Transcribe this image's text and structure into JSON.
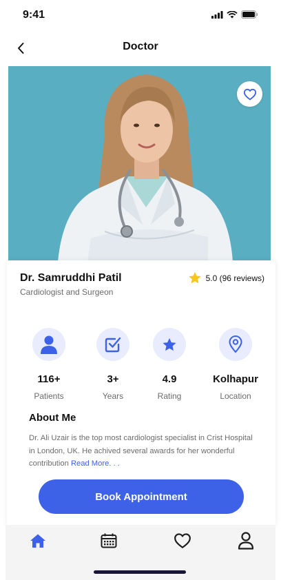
{
  "status_bar": {
    "time": "9:41"
  },
  "header": {
    "title": "Doctor"
  },
  "doctor": {
    "name": "Dr. Samruddhi Patil",
    "specialty": "Cardiologist and Surgeon",
    "rating_text": "5.0 (96 reviews)"
  },
  "stats": [
    {
      "value": "116+",
      "label": "Patients",
      "icon": "user-icon"
    },
    {
      "value": "3+",
      "label": "Years",
      "icon": "checkbox-icon"
    },
    {
      "value": "4.9",
      "label": "Rating",
      "icon": "star-icon"
    },
    {
      "value": "Kolhapur",
      "label": "Location",
      "icon": "location-pin-icon"
    }
  ],
  "about": {
    "title": "About Me",
    "text": "Dr. Ali Uzair is the top most cardiologist specialist in Crist Hospital in London, UK. He achived several awards for her wonderful contribution",
    "read_more": "Read More. . ."
  },
  "book_button": {
    "label": "Book Appointment"
  },
  "nav": [
    {
      "icon": "home-icon",
      "active": true
    },
    {
      "icon": "calendar-icon",
      "active": false
    },
    {
      "icon": "heart-icon",
      "active": false
    },
    {
      "icon": "profile-icon",
      "active": false
    }
  ],
  "colors": {
    "accent": "#3d62e8",
    "icon_bg": "#e8ecfc",
    "hero_bg": "#5aaec1",
    "star": "#f9c51b"
  }
}
